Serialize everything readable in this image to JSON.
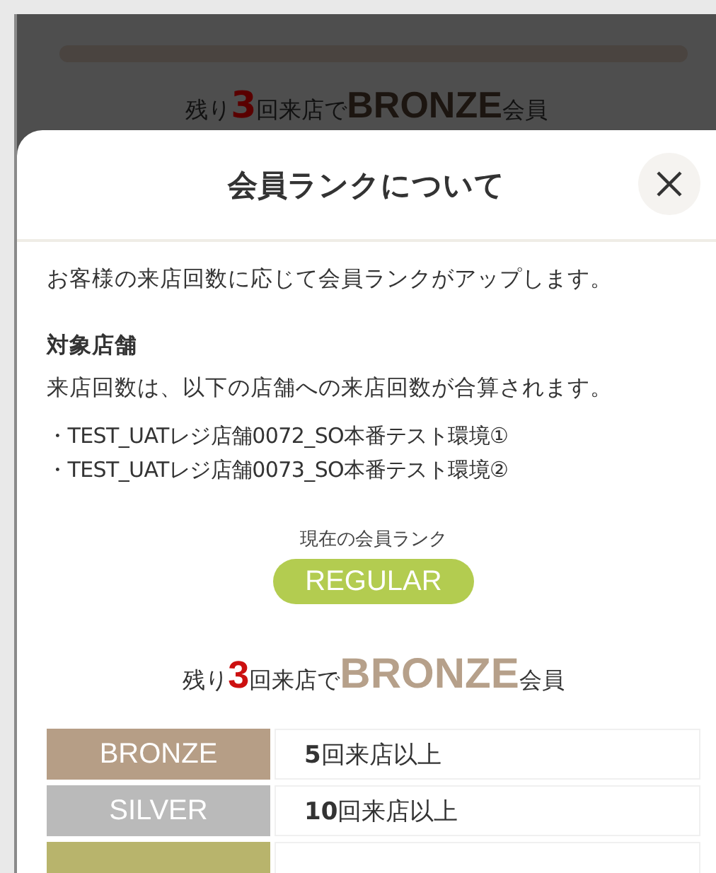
{
  "background": {
    "remaining": {
      "prefix": "残り",
      "count": "3",
      "middle": "回来店で",
      "rank": "BRONZE",
      "suffix": "会員"
    }
  },
  "modal": {
    "title": "会員ランクについて",
    "intro": "お客様の来店回数に応じて会員ランクがアップします。",
    "section_heading": "対象店舗",
    "section_text": "来店回数は、以下の店舗への来店回数が合算されます。",
    "stores": [
      "・TEST_UATレジ店舗0072_SO本番テスト環境①",
      "・TEST_UATレジ店舗0073_SO本番テスト環境②"
    ],
    "current_rank_label": "現在の会員ランク",
    "current_rank": {
      "name": "REGULAR",
      "color": "#b3cc50"
    },
    "remaining": {
      "prefix": "残り",
      "count": "3",
      "middle": "回来店で",
      "rank": "BRONZE",
      "color": "#b6a08a",
      "suffix": "会員"
    },
    "ranks": [
      {
        "name": "BRONZE",
        "color": "#b69e86",
        "requirement": "**5**回来店以上"
      },
      {
        "name": "SILVER",
        "color": "#bababa",
        "requirement": "**10**回来店以上"
      },
      {
        "color": "#b8b46c"
      }
    ]
  }
}
